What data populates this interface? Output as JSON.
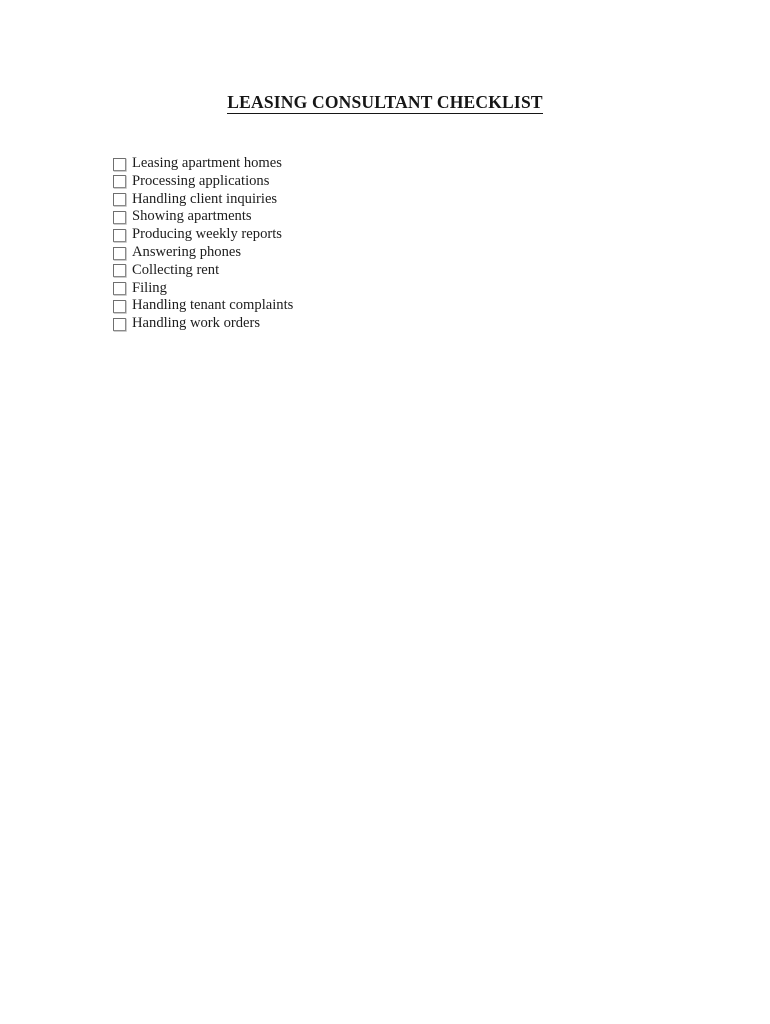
{
  "document": {
    "title": "LEASING CONSULTANT CHECKLIST",
    "background_color": "#ffffff",
    "text_color": "#1d1d1d",
    "checkbox_border_color": "#6f6f6f"
  },
  "checklist": {
    "items": [
      {
        "label": "Leasing apartment homes",
        "checked": false
      },
      {
        "label": "Processing applications",
        "checked": false
      },
      {
        "label": "Handling client inquiries",
        "checked": false
      },
      {
        "label": "Showing apartments",
        "checked": false
      },
      {
        "label": "Producing weekly reports",
        "checked": false
      },
      {
        "label": "Answering phones",
        "checked": false
      },
      {
        "label": "Collecting rent",
        "checked": false
      },
      {
        "label": "Filing",
        "checked": false
      },
      {
        "label": "Handling tenant complaints",
        "checked": false
      },
      {
        "label": "Handling work orders",
        "checked": false
      }
    ]
  }
}
